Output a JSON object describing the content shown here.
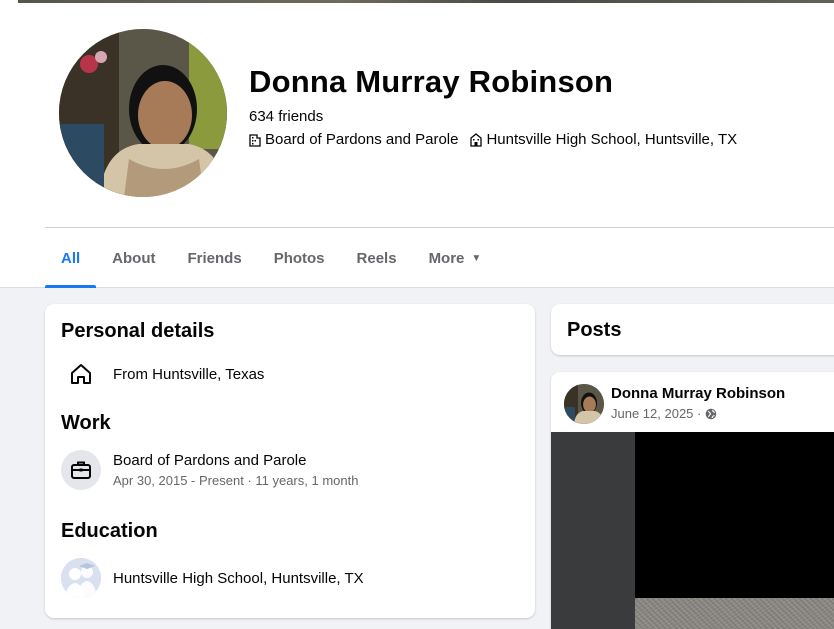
{
  "profile": {
    "name": "Donna Murray Robinson",
    "friends": "634 friends",
    "work_summary": "Board of Pardons and Parole",
    "education_summary": "Huntsville High School, Huntsville, TX"
  },
  "tabs": [
    {
      "label": "All",
      "active": true
    },
    {
      "label": "About"
    },
    {
      "label": "Friends"
    },
    {
      "label": "Photos"
    },
    {
      "label": "Reels"
    },
    {
      "label": "More"
    }
  ],
  "details": {
    "personal_title": "Personal details",
    "hometown": "From Huntsville, Texas",
    "work_title": "Work",
    "work_place": "Board of Pardons and Parole",
    "work_dates": "Apr 30, 2015 - Present · 11 years, 1 month",
    "education_title": "Education",
    "school": "Huntsville High School, Huntsville, TX"
  },
  "posts": {
    "title": "Posts",
    "post": {
      "author": "Donna Murray Robinson",
      "date": "June 12, 2025 ·"
    }
  },
  "colors": {
    "accent": "#1877f2",
    "secondary_text": "#65676b",
    "background": "#f0f2f5"
  },
  "icons": [
    "home-icon",
    "briefcase-icon",
    "school-icon",
    "globe-icon",
    "caret-down-icon"
  ]
}
